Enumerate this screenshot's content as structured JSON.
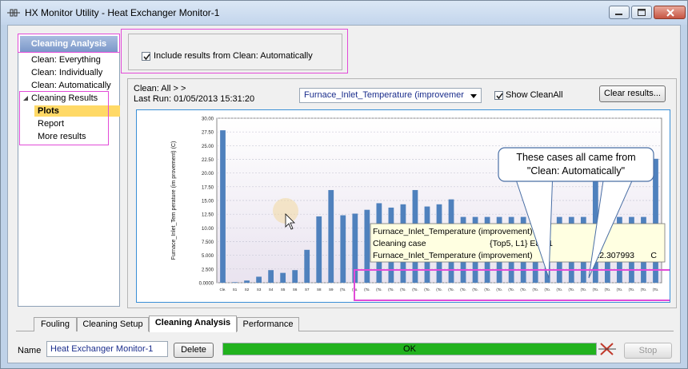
{
  "window": {
    "title": "HX Monitor Utility - Heat Exchanger Monitor-1"
  },
  "sidebar": {
    "header": "Cleaning Analysis",
    "items": [
      {
        "label": "Clean: Everything"
      },
      {
        "label": "Clean: Individually"
      },
      {
        "label": "Clean: Automatically"
      },
      {
        "label": "Cleaning Results"
      },
      {
        "label": "Plots",
        "selected": true
      },
      {
        "label": "Report"
      },
      {
        "label": "More results"
      }
    ]
  },
  "options": {
    "include_label": "Include results from Clean: Automatically",
    "include_checked": true
  },
  "plot_panel": {
    "clean_line": "Clean: All > >",
    "last_run": "Last Run: 01/05/2013 15:31:20",
    "variable_select": "Furnace_Inlet_Temperature (improvemer",
    "show_cleanall_label": "Show CleanAll",
    "show_cleanall_checked": true,
    "clear_button": "Clear results..."
  },
  "chart_data": {
    "type": "bar",
    "ylabel": "Furnace_Inlet_Tem perature (im provement) (C)",
    "ylim": [
      0,
      30
    ],
    "yticks": [
      "0.0000",
      "2.500",
      "5.000",
      "7.500",
      "10.00",
      "12.50",
      "15.00",
      "17.50",
      "20.00",
      "22.50",
      "25.00",
      "27.50",
      "30.00"
    ],
    "categories": [
      "Cle.",
      "S1",
      "S2",
      "S3",
      "S4",
      "S5",
      "S6",
      "S7",
      "S8",
      "S9",
      "(To.",
      "(To.",
      "(To.",
      "(To.",
      "(To.",
      "(To.",
      "(To.",
      "(To.",
      "(To.",
      "(To.",
      "(To.",
      "(To.",
      "(To.",
      "(To.",
      "(To.",
      "(To.",
      "(To.",
      "(To.",
      "(To.",
      "(To.",
      "(To.",
      "(To.",
      "(To.",
      "(To.",
      "(To.",
      "(To.",
      "(To."
    ],
    "values": [
      27.8,
      0.1,
      0.4,
      1.1,
      2.3,
      1.8,
      2.3,
      6.0,
      12.1,
      16.9,
      12.3,
      12.6,
      13.3,
      14.5,
      13.7,
      14.3,
      16.9,
      13.9,
      14.3,
      15.2,
      12.0,
      12.0,
      12.0,
      12.0,
      12.0,
      12.0,
      12.0,
      12.0,
      12.0,
      12.0,
      12.0,
      22.3,
      12.0,
      12.0,
      12.0,
      12.0,
      22.6
    ],
    "bar_color": "#4f81bd",
    "tooltip": {
      "line1": "Furnace_Inlet_Temperature (improvement)",
      "line2_label": "Cleaning case",
      "line2_value": "{Top5, L1} E8,E1",
      "line3_label": "Furnace_Inlet_Temperature (improvement)",
      "line3_value": "12.307993",
      "line3_unit": "C"
    },
    "annotation": "These cases all came from \"Clean: Automatically\""
  },
  "tabs": [
    {
      "label": "Fouling"
    },
    {
      "label": "Cleaning Setup"
    },
    {
      "label": "Cleaning Analysis",
      "active": true
    },
    {
      "label": "Performance"
    }
  ],
  "footer": {
    "name_label": "Name",
    "name_value": "Heat Exchanger Monitor-1",
    "delete_button": "Delete",
    "status_text": "OK",
    "progress": 1.0,
    "stop_button": "Stop"
  },
  "colors": {
    "highlight_frame": "#e24bd8",
    "progress_green": "#21b21e",
    "selected_item": "#ffd966"
  }
}
